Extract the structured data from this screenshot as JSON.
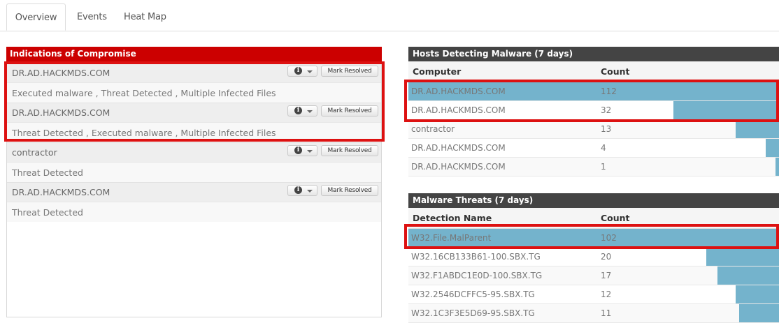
{
  "tabs": [
    {
      "label": "Overview",
      "active": true
    },
    {
      "label": "Events",
      "active": false
    },
    {
      "label": "Heat Map",
      "active": false
    }
  ],
  "ioc": {
    "title": "Indications of Compromise",
    "resolve_label": "Mark Resolved",
    "info_icon": "info-circle-icon",
    "items": [
      {
        "host": "DR.AD.HACKMDS.COM",
        "desc": "Executed malware , Threat Detected , Multiple Infected Files"
      },
      {
        "host": "DR.AD.HACKMDS.COM",
        "desc": "Threat Detected , Executed malware , Multiple Infected Files"
      },
      {
        "host": "contractor",
        "desc": "Threat Detected"
      },
      {
        "host": "DR.AD.HACKMDS.COM",
        "desc": "Threat Detected"
      }
    ]
  },
  "hosts_table": {
    "title": "Hosts Detecting Malware (7 days)",
    "col1": "Computer",
    "col2": "Count",
    "max": 112,
    "rows": [
      {
        "name": "DR.AD.HACKMDS.COM",
        "count": "112"
      },
      {
        "name": "DR.AD.HACKMDS.COM",
        "count": "32"
      },
      {
        "name": "contractor",
        "count": "13"
      },
      {
        "name": "DR.AD.HACKMDS.COM",
        "count": "4"
      },
      {
        "name": "DR.AD.HACKMDS.COM",
        "count": "1"
      }
    ]
  },
  "threats_table": {
    "title": "Malware Threats (7 days)",
    "col1": "Detection Name",
    "col2": "Count",
    "max": 102,
    "rows": [
      {
        "name": "W32.File.MalParent",
        "count": "102"
      },
      {
        "name": "W32.16CB133B61-100.SBX.TG",
        "count": "20"
      },
      {
        "name": "W32.F1ABDC1E0D-100.SBX.TG",
        "count": "17"
      },
      {
        "name": "W32.2546DCFFC5-95.SBX.TG",
        "count": "12"
      },
      {
        "name": "W32.1C3F3E5D69-95.SBX.TG",
        "count": "11"
      }
    ]
  },
  "colors": {
    "ioc_header": "#cc0000",
    "table_header": "#444444",
    "bar": "#74b3cc",
    "highlight": "#dd1111"
  }
}
